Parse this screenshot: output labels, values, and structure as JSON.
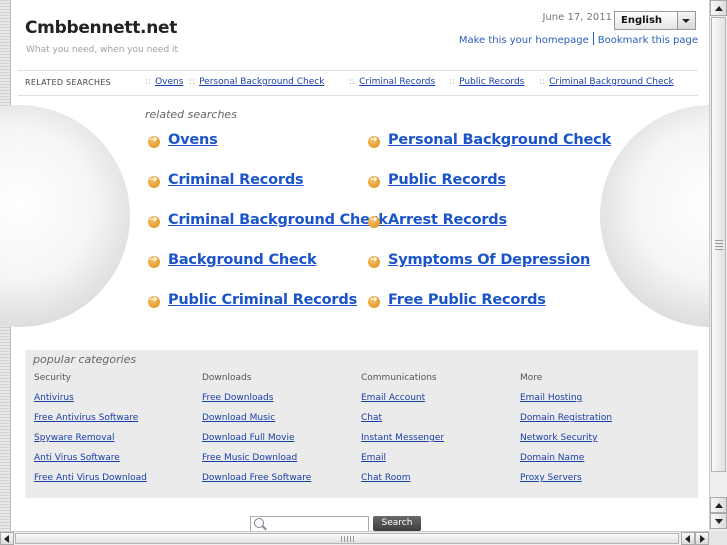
{
  "header": {
    "site_title": "Cmbbennett.net",
    "tagline": "What you need, when you need it",
    "date": "June 17, 2011",
    "language": "English",
    "make_homepage": "Make this your homepage",
    "bookmark": "Bookmark this page"
  },
  "related_bar": {
    "label": "RELATED SEARCHES",
    "separator": "::",
    "items": [
      "Ovens",
      "Personal Background Check",
      "Criminal Records",
      "Public Records",
      "Criminal Background Check"
    ]
  },
  "related_searches": {
    "title": "related searches",
    "links": [
      "Ovens",
      "Personal Background Check",
      "Criminal Records",
      "Public Records",
      "Criminal Background Check",
      "Arrest Records",
      "Background Check",
      "Symptoms Of Depression",
      "Public Criminal Records",
      "Free Public Records"
    ]
  },
  "popular": {
    "title": "popular categories",
    "columns": [
      {
        "heading": "Security",
        "links": [
          "Antivirus",
          "Free Antivirus Software",
          "Spyware Removal",
          "Anti Virus Software",
          "Free Anti Virus Download"
        ]
      },
      {
        "heading": "Downloads",
        "links": [
          "Free Downloads",
          "Download Music",
          "Download Full Movie",
          "Free Music Download",
          "Download Free Software"
        ]
      },
      {
        "heading": "Communications",
        "links": [
          "Email Account",
          "Chat",
          "Instant Messenger",
          "Email",
          "Chat Room"
        ]
      },
      {
        "heading": "More",
        "links": [
          "Email Hosting",
          "Domain Registration",
          "Network Security",
          "Domain Name",
          "Proxy Servers"
        ]
      }
    ]
  },
  "search": {
    "value": "",
    "button_label": "Search"
  },
  "colors": {
    "link": "#1a54c8",
    "small_link": "#1a3fa8",
    "arrow_bullet": "#e08a10",
    "popular_bg": "#ebebeb"
  }
}
